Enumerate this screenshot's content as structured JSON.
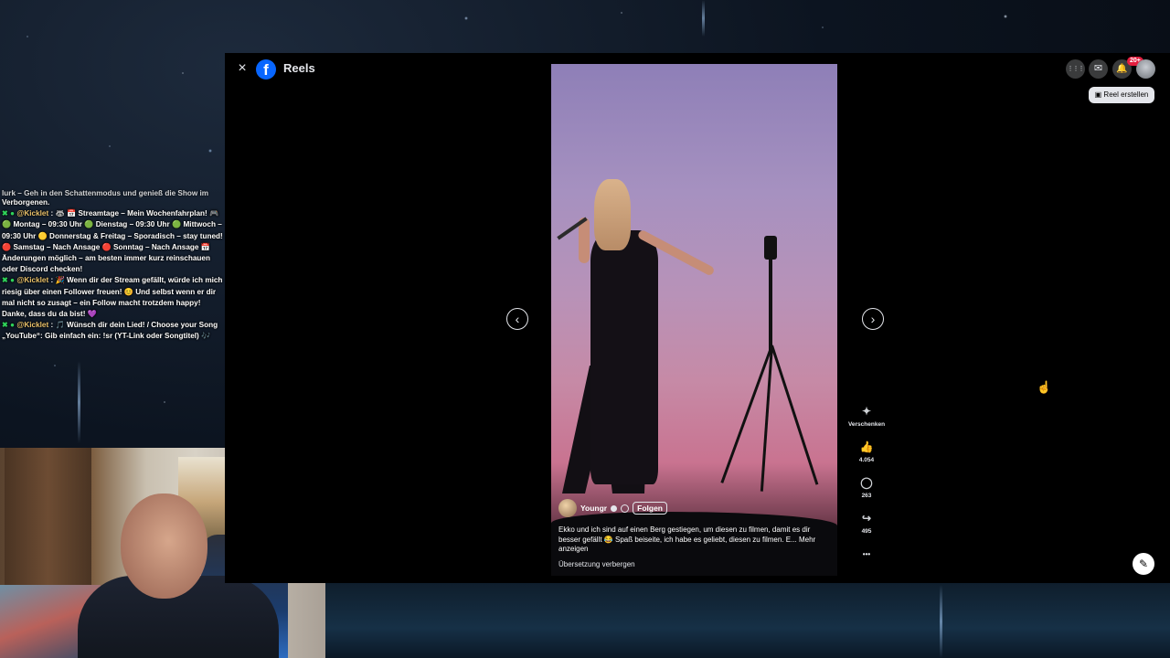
{
  "chat": {
    "messages": [
      {
        "cut": true,
        "text": "lurk – Geh in den Schattenmodus und genieß die Show im"
      },
      {
        "text": "Verborgenen."
      },
      {
        "badge": "✖ ●",
        "user": "@Kicklet",
        "text": ": 🦝 📅 Streamtage – Mein Wochenfahrplan! 🎮 🟢 Montag – 09:30 Uhr 🟢 Dienstag – 09:30 Uhr 🟢 Mittwoch – 09:30 Uhr 🟡 Donnerstag & Freitag – Sporadisch – stay tuned! 🔴 Samstag – Nach Ansage 🔴 Sonntag – Nach Ansage 📅 Änderungen möglich – am besten immer kurz reinschauen oder Discord checken!"
      },
      {
        "badge": "✖ ●",
        "user": "@Kicklet",
        "text": ": 🎉 Wenn dir der Stream gefällt, würde ich mich riesig über einen Follower freuen! 😊 Und selbst wenn er dir mal nicht so zusagt – ein Follow macht trotzdem happy! Danke, dass du da bist! 💜"
      },
      {
        "badge": "✖ ●",
        "user": "@Kicklet",
        "text": ": 🎵 Wünsch dir dein Lied! / Choose your Song „YouTube“: Gib einfach ein: !sr (YT-Link oder Songtitel) 🎶"
      }
    ]
  },
  "header": {
    "close_icon": "×",
    "logo_letter": "f",
    "title": "Reels",
    "notification_count": "20+",
    "create_reel_label": "Reel erstellen"
  },
  "reel": {
    "author": "Youngr",
    "follow_label": "Folgen",
    "caption": "Ekko und ich sind auf einen Berg gestiegen, um diesen zu filmen, damit es dir besser gefällt 😂 Spaß beiseite, ich habe es geliebt, diesen zu filmen. E... Mehr anzeigen",
    "translation_toggle": "Übersetzung verbergen"
  },
  "actions": {
    "gift_label": "Verschenken",
    "likes": "4.054",
    "comments": "263",
    "shares": "495"
  },
  "icons": {
    "prev": "‹",
    "next": "›",
    "apps": "⋮⋮⋮",
    "messenger": "✉",
    "bell": "🔔",
    "gift": "✦",
    "like": "👍",
    "comment": "◯",
    "share": "↪",
    "more": "•••",
    "edit": "✎"
  }
}
